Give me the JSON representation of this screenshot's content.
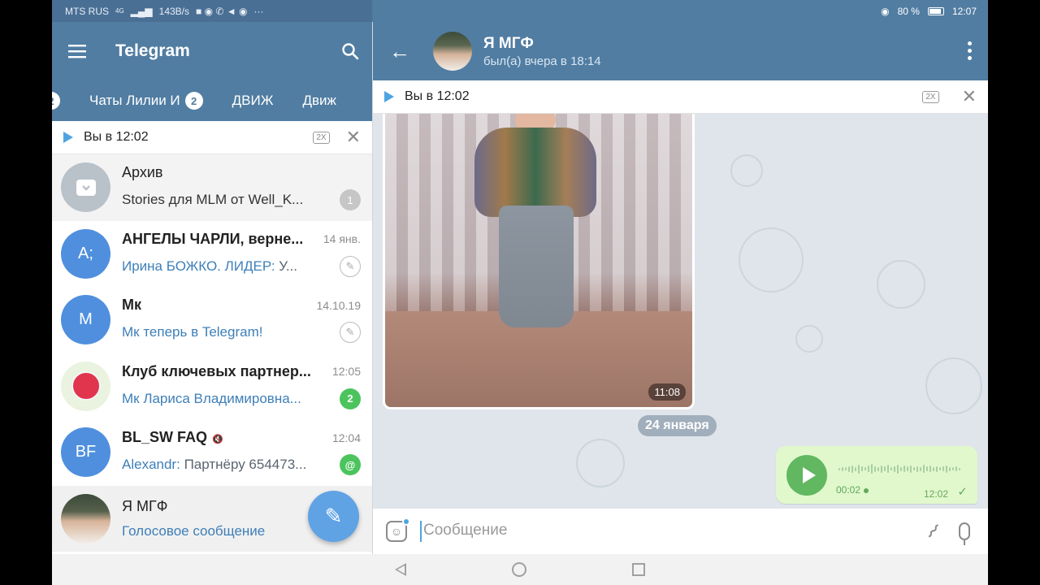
{
  "status_bar": {
    "left": {
      "carrier": "MTS RUS",
      "network": "4G",
      "speed": "143B/s",
      "extra": "···"
    },
    "right": {
      "battery": "80 %",
      "time": "12:07"
    }
  },
  "left_panel": {
    "title": "Telegram",
    "tabs": [
      {
        "label": "",
        "badge": "2"
      },
      {
        "label": "Чаты Лилии И",
        "badge": "2"
      },
      {
        "label": "ДВИЖ",
        "badge": ""
      },
      {
        "label": "Движ",
        "badge": ""
      }
    ],
    "player": {
      "label": "Вы в 12:02",
      "speed": "2X"
    },
    "chats": [
      {
        "name": "Архив",
        "date": "",
        "message": "Stories для MLM от Well_K...",
        "badge": "1",
        "avatar_letter": ""
      },
      {
        "name": "АНГЕЛЫ ЧАРЛИ, верне...",
        "date": "14 янв.",
        "sender": "Ирина БОЖКО. ЛИДЕР:",
        "message": "У...",
        "avatar_letter": "А;"
      },
      {
        "name": "Мк",
        "date": "14.10.19",
        "message": "Мк теперь в Telegram!",
        "avatar_letter": "М"
      },
      {
        "name": "Клуб ключевых партнер...",
        "date": "12:05",
        "message": "Мк Лариса Владимировна...",
        "badge": "2"
      },
      {
        "name": "BL_SW FAQ",
        "date": "12:04",
        "sender": "Alexandr:",
        "message": "Партнёру 654473...",
        "badge": "@",
        "avatar_letter": "BF"
      },
      {
        "name": "Я МГФ",
        "date": "",
        "message": "Голосовое сообщение"
      }
    ]
  },
  "right_panel": {
    "chat_name": "Я МГФ",
    "chat_status": "был(а) вчера в 18:14",
    "player": {
      "label": "Вы в 12:02",
      "speed": "2X"
    },
    "video_time": "11:08",
    "date_separator": "24 января",
    "voice": {
      "duration": "00:02",
      "time": "12:02"
    },
    "composer_placeholder": "Сообщение"
  },
  "colors": {
    "header": "#517da2",
    "accent": "#4ea4e0",
    "bubble_out": "#e1f8cc",
    "green": "#4cc45e"
  }
}
